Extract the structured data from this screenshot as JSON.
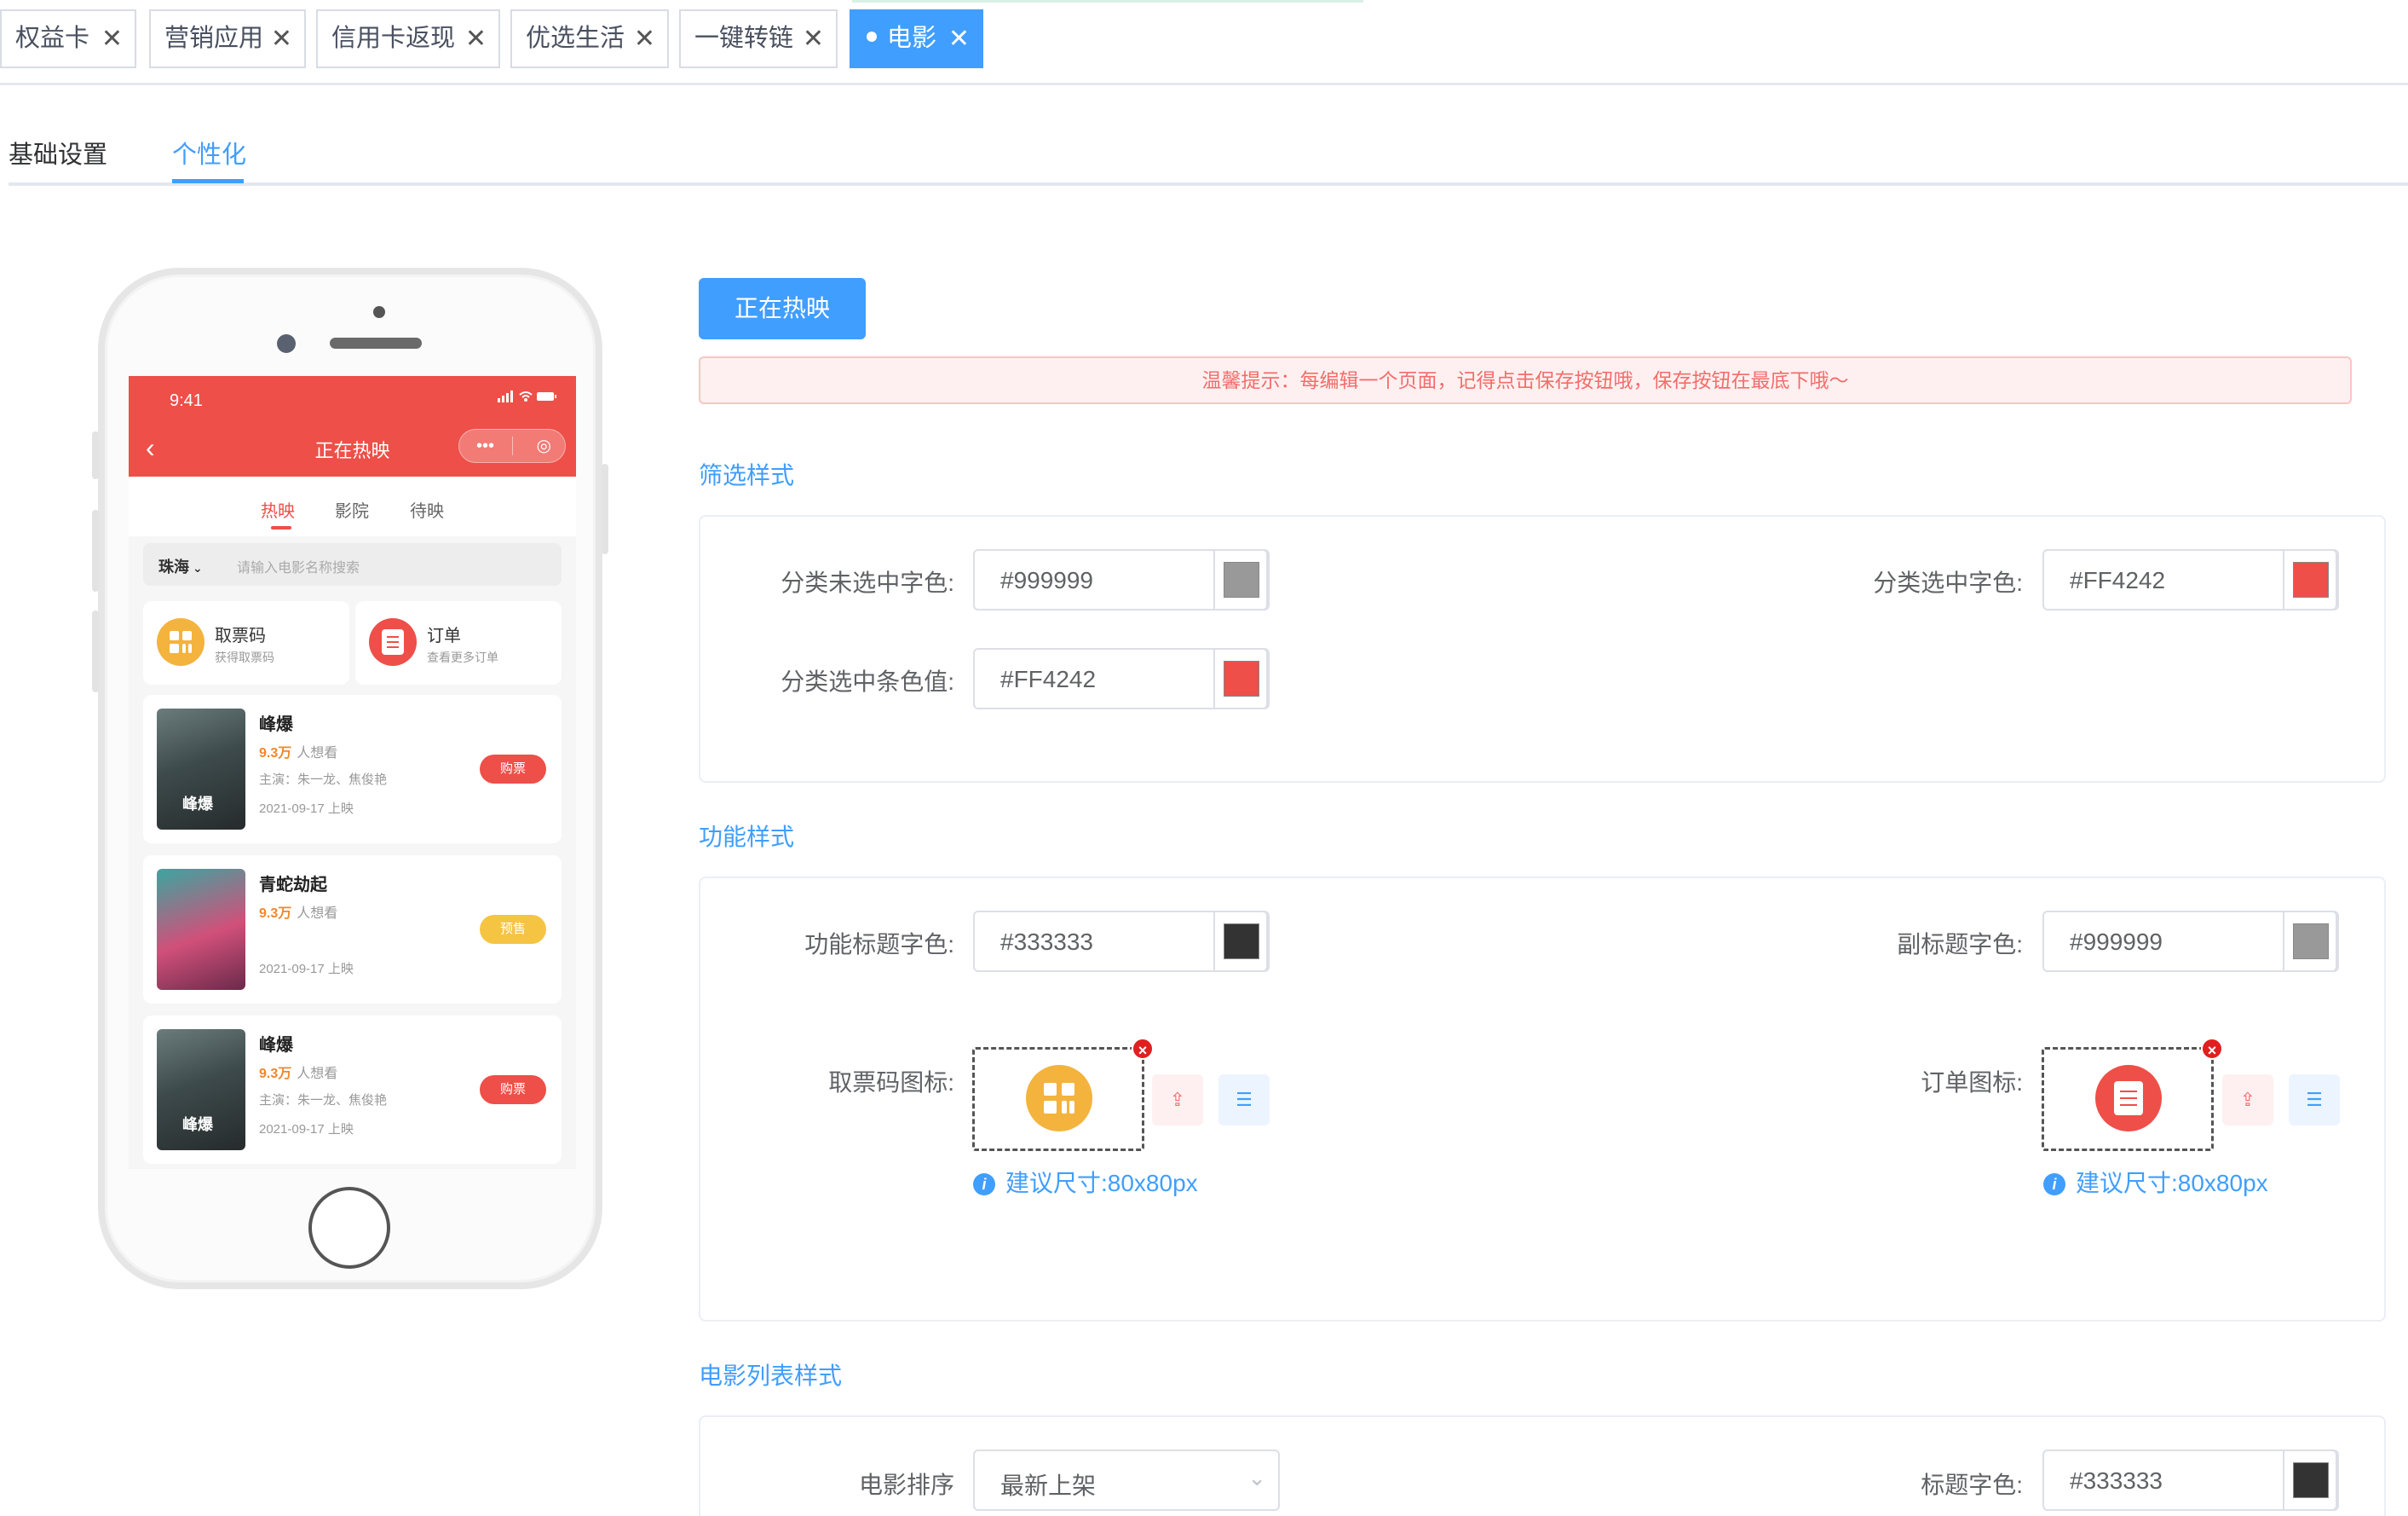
{
  "tabs": [
    {
      "label": "权益卡",
      "active": false
    },
    {
      "label": "营销应用",
      "active": false
    },
    {
      "label": "信用卡返现",
      "active": false
    },
    {
      "label": "优选生活",
      "active": false
    },
    {
      "label": "一键转链",
      "active": false
    },
    {
      "label": "电影",
      "active": true
    }
  ],
  "close_glyph": "✕",
  "subtabs": [
    {
      "label": "基础设置",
      "active": false
    },
    {
      "label": "个性化",
      "active": true
    }
  ],
  "phone": {
    "time": "9:41",
    "status_icons": "signal-wifi-battery",
    "title": "正在热映",
    "back_glyph": "‹",
    "capsule_more": "•••",
    "capsule_close": "◎",
    "nav": [
      "热映",
      "影院",
      "待映"
    ],
    "city": "珠海",
    "city_chevron": "⌄",
    "search_placeholder": "请输入电影名称搜索",
    "functions": [
      {
        "title": "取票码",
        "subtitle": "获得取票码",
        "color": "#f3b33d"
      },
      {
        "title": "订单",
        "subtitle": "查看更多订单",
        "color": "#ee4f48"
      }
    ],
    "movies": [
      {
        "name": "峰爆",
        "want_num": "9.3万",
        "want_label": "人想看",
        "actors": "主演：朱一龙、焦俊艳",
        "date": "2021-09-17 上映",
        "button": "购票",
        "button_color": "#ee4f48",
        "poster_text": "峰爆"
      },
      {
        "name": "青蛇劫起",
        "want_num": "9.3万",
        "want_label": "人想看",
        "actors": "",
        "date": "2021-09-17 上映",
        "button": "预售",
        "button_color": "#f6c443",
        "poster_text": ""
      },
      {
        "name": "峰爆",
        "want_num": "9.3万",
        "want_label": "人想看",
        "actors": "主演：朱一龙、焦俊艳",
        "date": "2021-09-17 上映",
        "button": "购票",
        "button_color": "#ee4f48",
        "poster_text": "峰爆"
      }
    ]
  },
  "config": {
    "page_button": "正在热映",
    "tip": "温馨提示：每编辑一个页面，记得点击保存按钮哦，保存按钮在最底下哦～",
    "filter": {
      "title": "筛选样式",
      "unselected_label": "分类未选中字色:",
      "unselected_value": "#999999",
      "selected_label": "分类选中字色:",
      "selected_value": "#FF4242",
      "bar_label": "分类选中条色值:",
      "bar_value": "#FF4242"
    },
    "function": {
      "title": "功能样式",
      "title_color_label": "功能标题字色:",
      "title_color_value": "#333333",
      "subtitle_color_label": "副标题字色:",
      "subtitle_color_value": "#999999",
      "ticket_icon_label": "取票码图标:",
      "order_icon_label": "订单图标:",
      "size_hint": "建议尺寸:80x80px",
      "hint_glyph": "i",
      "upload_glyph": "⇪",
      "list_glyph": "☰",
      "delete_glyph": "×"
    },
    "movie_list": {
      "title": "电影列表样式",
      "sort_label": "电影排序",
      "sort_value": "最新上架",
      "select_chevron": "⌄",
      "title_color_label": "标题字色:",
      "title_color_value": "#333333"
    }
  },
  "colors": {
    "accent": "#409eff",
    "swatch_grey": "#999999",
    "swatch_red": "#ee4f48",
    "swatch_dark": "#333333"
  }
}
